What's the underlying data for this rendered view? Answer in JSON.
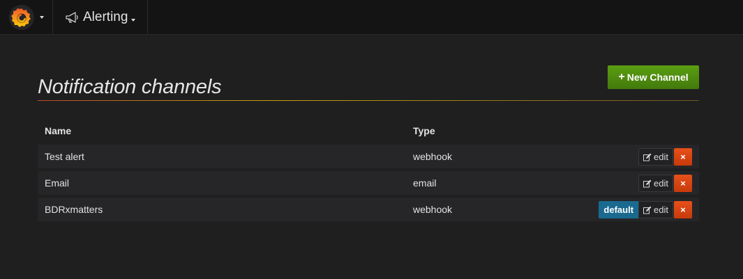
{
  "navbar": {
    "logo_icon": "grafana-logo-icon",
    "section_icon": "megaphone-icon",
    "section_title": "Alerting"
  },
  "page": {
    "title": "Notification channels",
    "new_button_icon": "plus-icon",
    "new_button_label": "New Channel"
  },
  "table": {
    "columns": [
      "Name",
      "Type"
    ],
    "rows": [
      {
        "name": "Test alert",
        "type": "webhook",
        "is_default": false
      },
      {
        "name": "Email",
        "type": "email",
        "is_default": false
      },
      {
        "name": "BDRxmatters",
        "type": "webhook",
        "is_default": true
      }
    ],
    "default_badge_label": "default",
    "edit_label": "edit",
    "delete_glyph": "×"
  },
  "colors": {
    "accent_green": "#508a10",
    "delete_red": "#e0460f",
    "default_badge": "#1a6a8f"
  }
}
